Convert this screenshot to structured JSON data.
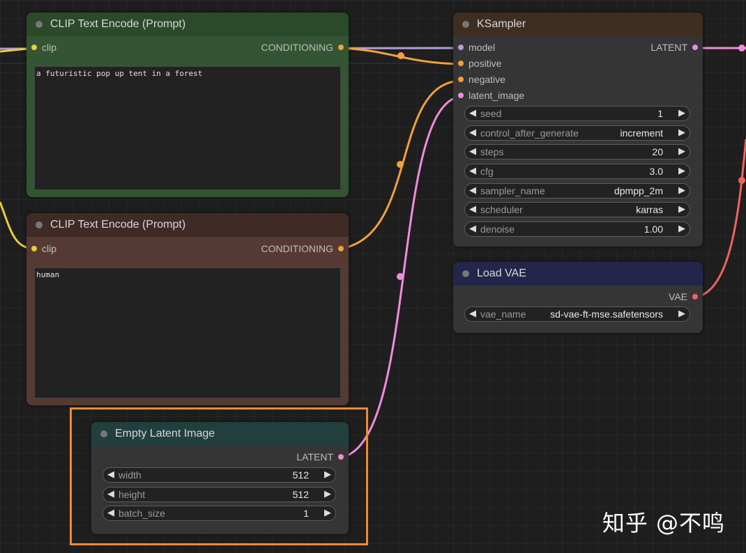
{
  "colors": {
    "clip": "#e8cc3a",
    "conditioning": "#f0a13a",
    "latent": "#f08cdc",
    "model": "#b39ddb",
    "vae": "#f06262",
    "selection": "#f08a32"
  },
  "nodes": {
    "clip_pos": {
      "title": "CLIP Text Encode (Prompt)",
      "input": "clip",
      "output": "CONDITIONING",
      "text": "a futuristic pop up tent in a forest"
    },
    "clip_neg": {
      "title": "CLIP Text Encode (Prompt)",
      "input": "clip",
      "output": "CONDITIONING",
      "text": "human"
    },
    "ksampler": {
      "title": "KSampler",
      "inputs": [
        "model",
        "positive",
        "negative",
        "latent_image"
      ],
      "output": "LATENT",
      "widgets": [
        {
          "name": "seed",
          "value": "1"
        },
        {
          "name": "control_after_generate",
          "value": "increment"
        },
        {
          "name": "steps",
          "value": "20"
        },
        {
          "name": "cfg",
          "value": "3.0"
        },
        {
          "name": "sampler_name",
          "value": "dpmpp_2m"
        },
        {
          "name": "scheduler",
          "value": "karras"
        },
        {
          "name": "denoise",
          "value": "1.00"
        }
      ]
    },
    "load_vae": {
      "title": "Load VAE",
      "output": "VAE",
      "widgets": [
        {
          "name": "vae_name",
          "value": "sd-vae-ft-mse.safetensors"
        }
      ]
    },
    "empty_latent": {
      "title": "Empty Latent Image",
      "output": "LATENT",
      "widgets": [
        {
          "name": "width",
          "value": "512"
        },
        {
          "name": "height",
          "value": "512"
        },
        {
          "name": "batch_size",
          "value": "1"
        }
      ]
    }
  },
  "watermark": "知乎 @不鸣"
}
